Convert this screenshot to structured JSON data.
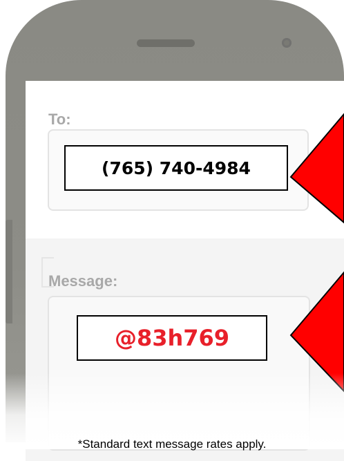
{
  "to_field": {
    "label": "To:",
    "value": "(765) 740-4984"
  },
  "message_field": {
    "label": "Message:",
    "value": "@83h769"
  },
  "disclaimer": "*Standard text message rates apply.",
  "colors": {
    "phone_body": "#8d8d87",
    "arrow": "#ff0000",
    "code_text": "#e8202a",
    "label_text": "#a8a8a8"
  },
  "icons": [
    "speaker-grille",
    "front-camera",
    "arrow-pointer"
  ]
}
